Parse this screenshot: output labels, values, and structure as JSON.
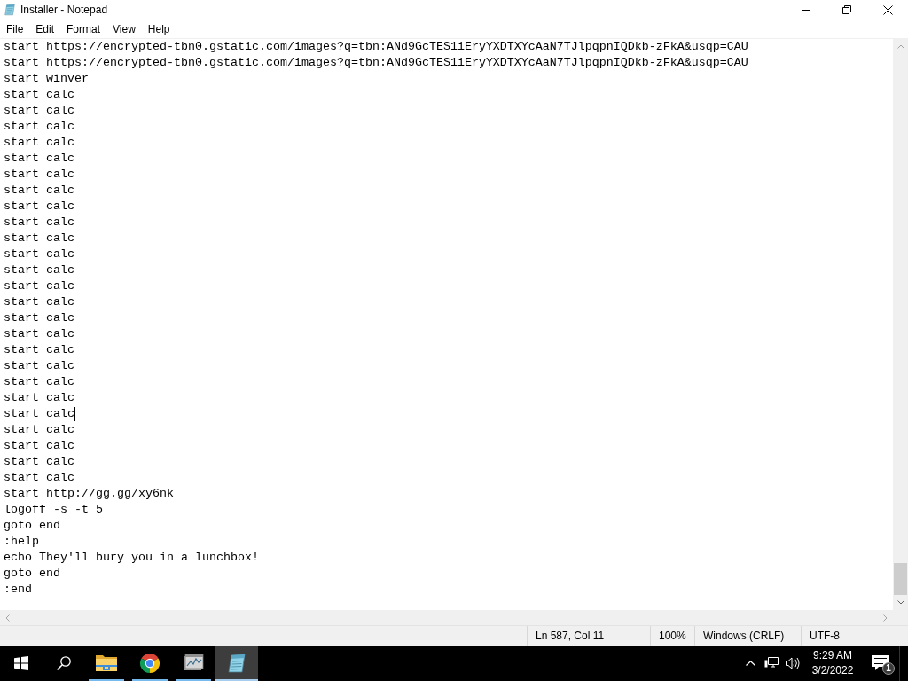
{
  "window": {
    "title": "Installer - Notepad",
    "controls": [
      {
        "kind": "minimize"
      },
      {
        "kind": "restore"
      },
      {
        "kind": "close"
      }
    ]
  },
  "menu": [
    "File",
    "Edit",
    "Format",
    "View",
    "Help"
  ],
  "editor": {
    "lines": [
      {
        "text": "start https://encrypted-tbn0.gstatic.com/images?q=tbn:ANd9GcTES1iEryYXDTXYcAaN7TJlpqpnIQDkb-zFkA&usqp=CAU",
        "caret": false
      },
      {
        "text": "start https://encrypted-tbn0.gstatic.com/images?q=tbn:ANd9GcTES1iEryYXDTXYcAaN7TJlpqpnIQDkb-zFkA&usqp=CAU",
        "caret": false
      },
      {
        "text": "start winver",
        "caret": false
      },
      {
        "text": "start calc",
        "caret": false
      },
      {
        "text": "start calc",
        "caret": false
      },
      {
        "text": "start calc",
        "caret": false
      },
      {
        "text": "start calc",
        "caret": false
      },
      {
        "text": "start calc",
        "caret": false
      },
      {
        "text": "start calc",
        "caret": false
      },
      {
        "text": "start calc",
        "caret": false
      },
      {
        "text": "start calc",
        "caret": false
      },
      {
        "text": "start calc",
        "caret": false
      },
      {
        "text": "start calc",
        "caret": false
      },
      {
        "text": "start calc",
        "caret": false
      },
      {
        "text": "start calc",
        "caret": false
      },
      {
        "text": "start calc",
        "caret": false
      },
      {
        "text": "start calc",
        "caret": false
      },
      {
        "text": "start calc",
        "caret": false
      },
      {
        "text": "start calc",
        "caret": false
      },
      {
        "text": "start calc",
        "caret": false
      },
      {
        "text": "start calc",
        "caret": false
      },
      {
        "text": "start calc",
        "caret": false
      },
      {
        "text": "start calc",
        "caret": false
      },
      {
        "text": "start calc",
        "caret": true
      },
      {
        "text": "start calc",
        "caret": false
      },
      {
        "text": "start calc",
        "caret": false
      },
      {
        "text": "start calc",
        "caret": false
      },
      {
        "text": "start calc",
        "caret": false
      },
      {
        "text": "start http://gg.gg/xy6nk",
        "caret": false
      },
      {
        "text": "logoff -s -t 5",
        "caret": false
      },
      {
        "text": "goto end",
        "caret": false
      },
      {
        "text": ":help",
        "caret": false
      },
      {
        "text": "echo They'll bury you in a lunchbox!",
        "caret": false
      },
      {
        "text": "goto end",
        "caret": false
      },
      {
        "text": ":end",
        "caret": false
      }
    ]
  },
  "status_bar": [
    "Ln 587, Col 11",
    "100%",
    "Windows (CRLF)",
    "UTF-8"
  ],
  "taskbar": {
    "buttons": [
      {
        "kind": "start"
      },
      {
        "kind": "search"
      }
    ],
    "apps": [
      {
        "kind": "folder",
        "running": true,
        "selected": false
      },
      {
        "kind": "browser",
        "running": true,
        "selected": false
      },
      {
        "kind": "chart-window",
        "running": true,
        "selected": false
      },
      {
        "kind": "notepad",
        "running": true,
        "selected": true
      }
    ],
    "tray": {
      "icons": [
        {
          "kind": "chevron"
        },
        {
          "kind": "network"
        },
        {
          "kind": "volume"
        }
      ],
      "time": "9:29 AM",
      "date": "3/2/2022",
      "notifications": "1"
    }
  }
}
